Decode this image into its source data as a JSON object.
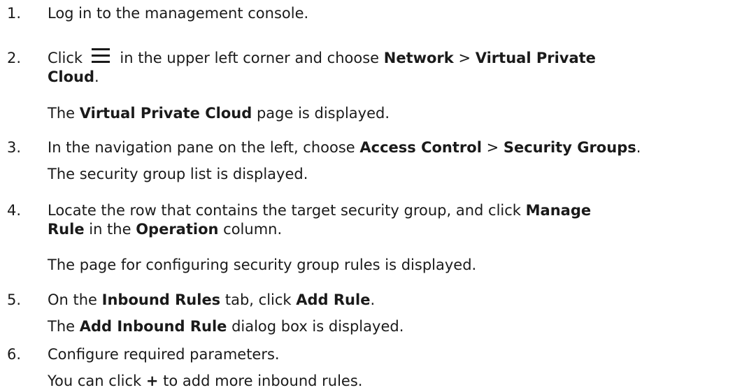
{
  "steps": [
    {
      "number": "1.",
      "text": "Log in to the management console."
    },
    {
      "number": "2.",
      "pre_icon": "Click",
      "icon": "menu-icon",
      "post_icon": " in the upper left corner and choose ",
      "bold1": "Network",
      "sep": " > ",
      "bold2": "Virtual Private",
      "bold2_cont": "Cloud",
      "end": ".",
      "result_pre": "The ",
      "result_bold": "Virtual Private Cloud",
      "result_post": " page is displayed."
    },
    {
      "number": "3.",
      "pre": "In the navigation pane on the left, choose ",
      "bold1": "Access Control",
      "sep": " > ",
      "bold2": "Security Groups",
      "end": ".",
      "result": "The security group list is displayed."
    },
    {
      "number": "4.",
      "pre": "Locate the row that contains the target security group, and click ",
      "bold1": "Manage",
      "bold1_cont": "Rule",
      "mid": " in the ",
      "bold2": "Operation",
      "post": " column.",
      "result": "The page for configuring security group rules is displayed."
    },
    {
      "number": "5.",
      "pre": "On the ",
      "bold1": "Inbound Rules",
      "mid": " tab, click ",
      "bold2": "Add Rule",
      "end": ".",
      "result_pre": "The ",
      "result_bold": "Add Inbound Rule",
      "result_post": " dialog box is displayed."
    },
    {
      "number": "6.",
      "text": "Configure required parameters.",
      "result_pre": "You can click ",
      "result_bold": "+",
      "result_post": " to add more inbound rules."
    }
  ]
}
